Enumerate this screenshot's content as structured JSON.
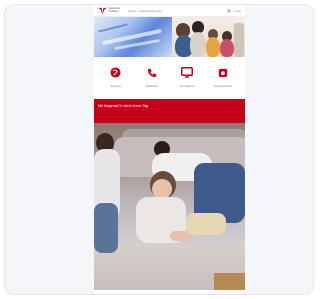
{
  "header": {
    "logo_text": "Deutsche Telekom",
    "nav": [
      "Privat",
      "Geschäftskunden"
    ],
    "right_label": "Login"
  },
  "quick_links": [
    {
      "label": "Internet",
      "icon": "globe-icon"
    },
    {
      "label": "Telefonie",
      "icon": "phone-icon"
    },
    {
      "label": "Fernsehen",
      "icon": "tv-icon"
    },
    {
      "label": "Unternehmen",
      "icon": "camera-icon"
    }
  ],
  "promo": {
    "text": "Mit MagentaTV durch Ihren Tag"
  },
  "colors": {
    "brand_red": "#c4001a",
    "page_bg": "#f5f6fa"
  }
}
